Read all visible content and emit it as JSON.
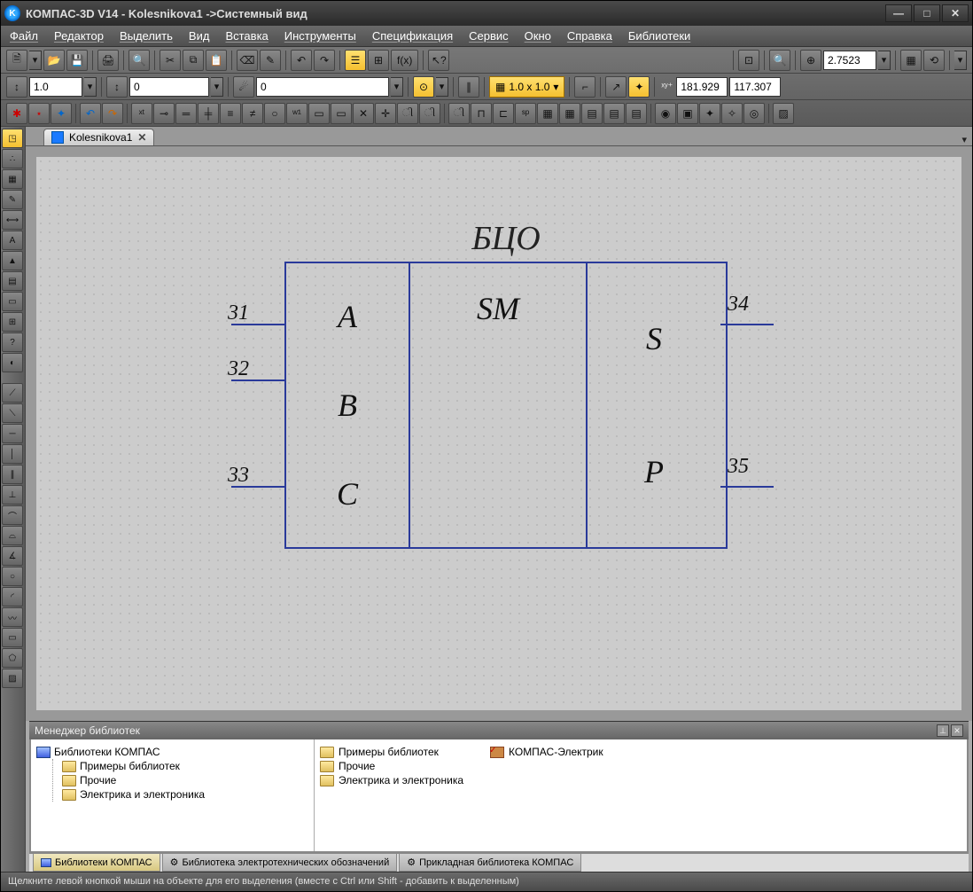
{
  "title": "КОМПАС-3D V14 - Kolesnikova1 ->Системный вид",
  "menu": [
    "Файл",
    "Редактор",
    "Выделить",
    "Вид",
    "Вставка",
    "Инструменты",
    "Спецификация",
    "Сервис",
    "Окно",
    "Справка",
    "Библиотеки"
  ],
  "toolbar1": {
    "zoom": "2.7523",
    "fx": "f(x)"
  },
  "toolbar2": {
    "v1": "1.0",
    "v2": "0",
    "v3": "0",
    "grid": "1.0 x 1.0",
    "coordX": "181.929",
    "coordY": "117.307"
  },
  "tab": {
    "name": "Kolesnikova1"
  },
  "diagram": {
    "title": "БЦО",
    "col1": [
      "A",
      "B",
      "C"
    ],
    "col2": "SM",
    "col3": [
      "S",
      "P"
    ],
    "pinsLeft": [
      "31",
      "32",
      "33"
    ],
    "pinsRight": [
      "34",
      "35"
    ]
  },
  "libmgr": {
    "header": "Менеджер библиотек",
    "tree_root": "Библиотеки КОМПАС",
    "tree_children": [
      "Примеры библиотек",
      "Прочие",
      "Электрика и электроника"
    ],
    "list_col1": [
      "Примеры библиотек",
      "Прочие",
      "Электрика и электроника"
    ],
    "list_col2": [
      "КОМПАС-Электрик"
    ]
  },
  "bottomtabs": [
    "Библиотеки КОМПАС",
    "Библиотека электротехнических обозначений",
    "Прикладная библиотека КОМПАС"
  ],
  "status": "Щелкните левой кнопкой мыши на объекте для его выделения (вместе с Ctrl или Shift - добавить к выделенным)"
}
